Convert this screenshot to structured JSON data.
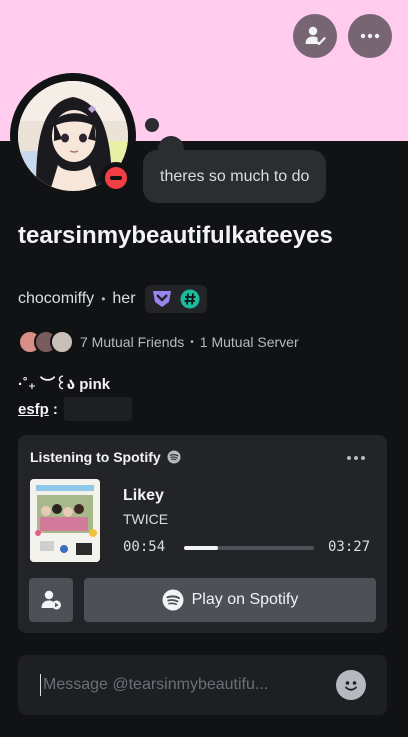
{
  "colors": {
    "banner": "#ffccee",
    "background": "#111214",
    "card": "#232428",
    "dnd": "#f23f43",
    "button": "#4e5058"
  },
  "header": {
    "add_friend_icon": "person-check-icon",
    "more_icon": "ellipsis-icon"
  },
  "status": {
    "text": "theres so much to do",
    "presence": "do-not-disturb"
  },
  "profile": {
    "display_name": "tearsinmybeautifulkateeyes",
    "username": "chocomiffy",
    "separator": "•",
    "pronouns": "her",
    "badges": [
      "hypesquad-icon",
      "hashtag-icon"
    ]
  },
  "mutuals": {
    "friends": "7 Mutual Friends",
    "separator": "•",
    "servers": "1 Mutual Server"
  },
  "bio": {
    "line1": "·˚₊ ︶꒰ა pink",
    "line2_link": "esfp",
    "line2_colon": ":"
  },
  "activity": {
    "header": "Listening to Spotify",
    "track": "Likey",
    "artist": "TWICE",
    "elapsed": "00:54",
    "duration": "03:27",
    "progress": 0.26,
    "play_label": "Play on Spotify"
  },
  "message": {
    "placeholder": "Message @tearsinmybeautifu..."
  }
}
